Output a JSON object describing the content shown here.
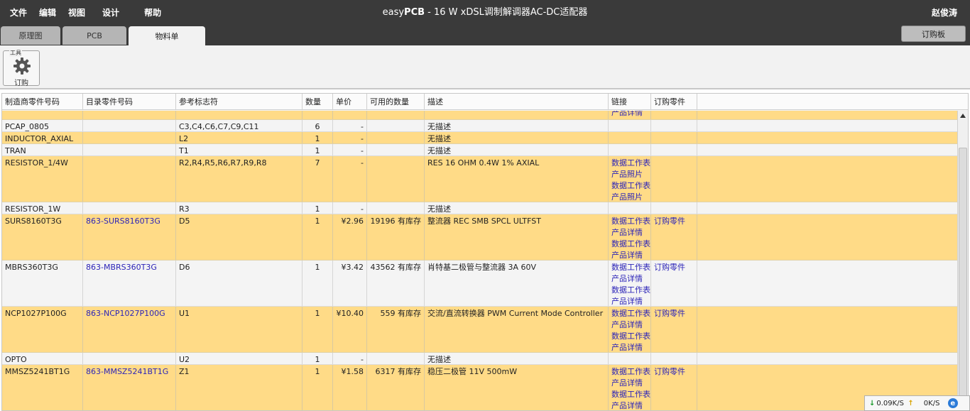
{
  "menu": [
    "文件",
    "编辑",
    "视图",
    "设计",
    "帮助"
  ],
  "app_title": {
    "brand_a": "easy",
    "brand_b": "PCB",
    "rest": " - 16 W xDSL调制解调器AC-DC适配器"
  },
  "user_name": "赵俊涛",
  "tabs": [
    "原理图",
    "PCB",
    "物料单"
  ],
  "active_tab": "物料单",
  "order_board_button": "订购板",
  "toolbar": {
    "group_label": "工具",
    "order_label": "订购"
  },
  "table": {
    "headers": [
      "制造商零件号码",
      "目录零件号码",
      "参考标志符",
      "数量",
      "单价",
      "可用的数量",
      "描述",
      "链接",
      "订购零件"
    ],
    "partial_row_link": "产品详情",
    "rows": [
      {
        "mfr": "PCAP_0805",
        "cat": "",
        "ref": "C3,C4,C6,C7,C9,C11",
        "qty": "6",
        "price": "-",
        "avail": "",
        "desc": "无描述",
        "links": [],
        "order": ""
      },
      {
        "mfr": "INDUCTOR_AXIAL",
        "cat": "",
        "ref": "L2",
        "qty": "1",
        "price": "-",
        "avail": "",
        "desc": "无描述",
        "links": [],
        "order": ""
      },
      {
        "mfr": "TRAN",
        "cat": "",
        "ref": "T1",
        "qty": "1",
        "price": "-",
        "avail": "",
        "desc": "无描述",
        "links": [],
        "order": ""
      },
      {
        "mfr": "RESISTOR_1/4W",
        "cat": "",
        "ref": "R2,R4,R5,R6,R7,R9,R8",
        "qty": "7",
        "price": "-",
        "avail": "",
        "desc": "RES 16 OHM 0.4W 1% AXIAL",
        "links": [
          "数据工作表",
          "产品照片",
          "数据工作表",
          "产品照片"
        ],
        "order": ""
      },
      {
        "mfr": "RESISTOR_1W",
        "cat": "",
        "ref": "R3",
        "qty": "1",
        "price": "-",
        "avail": "",
        "desc": "无描述",
        "links": [],
        "order": ""
      },
      {
        "mfr": "SURS8160T3G",
        "cat": "863-SURS8160T3G",
        "ref": "D5",
        "qty": "1",
        "price": "¥2.96",
        "avail": "19196 有库存",
        "desc": "整流器 REC SMB SPCL ULTFST",
        "links": [
          "数据工作表",
          "产品详情",
          "数据工作表",
          "产品详情"
        ],
        "order": "订购零件"
      },
      {
        "mfr": "MBRS360T3G",
        "cat": "863-MBRS360T3G",
        "ref": "D6",
        "qty": "1",
        "price": "¥3.42",
        "avail": "43562 有库存",
        "desc": "肖特基二极管与整流器 3A 60V",
        "links": [
          "数据工作表",
          "产品详情",
          "数据工作表",
          "产品详情"
        ],
        "order": "订购零件"
      },
      {
        "mfr": "NCP1027P100G",
        "cat": "863-NCP1027P100G",
        "ref": "U1",
        "qty": "1",
        "price": "¥10.40",
        "avail": "559 有库存",
        "desc": "交流/直流转换器 PWM Current Mode Controller",
        "links": [
          "数据工作表",
          "产品详情",
          "数据工作表",
          "产品详情"
        ],
        "order": "订购零件"
      },
      {
        "mfr": "OPTO",
        "cat": "",
        "ref": "U2",
        "qty": "1",
        "price": "-",
        "avail": "",
        "desc": "无描述",
        "links": [],
        "order": ""
      },
      {
        "mfr": "MMSZ5241BT1G",
        "cat": "863-MMSZ5241BT1G",
        "ref": "Z1",
        "qty": "1",
        "price": "¥1.58",
        "avail": "6317 有库存",
        "desc": "稳压二极管 11V 500mW",
        "links": [
          "数据工作表",
          "产品详情",
          "数据工作表",
          "产品详情"
        ],
        "order": "订购零件"
      }
    ]
  },
  "netmon": {
    "down": "0.09K/S",
    "up": "0K/S"
  },
  "colors": {
    "row_highlight": "#ffdb87",
    "row_plain": "#f4f4f4",
    "link": "#2c24b8",
    "topbar": "#3a3a3a"
  }
}
